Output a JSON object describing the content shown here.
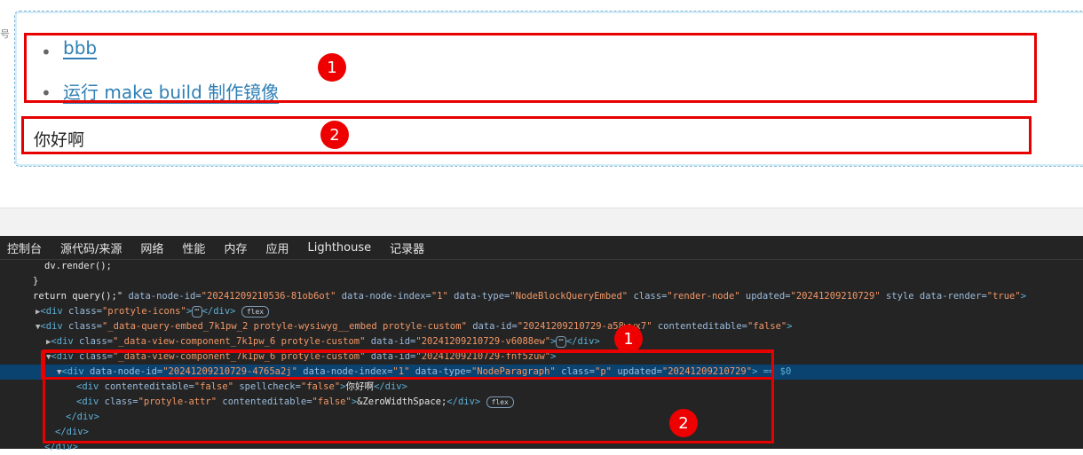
{
  "preview": {
    "side_mark": "号",
    "list_items": [
      {
        "label": "bbb"
      },
      {
        "label": "运行 make build 制作镜像"
      }
    ],
    "paragraph": "你好啊",
    "badges": [
      "1",
      "2"
    ]
  },
  "devtools": {
    "tabs": [
      "控制台",
      "源代码/来源",
      "网络",
      "性能",
      "内存",
      "应用",
      "Lighthouse",
      "记录器"
    ],
    "code_lines": {
      "l1": "dv.render();",
      "l2": "}",
      "l3_a": "return query();\"",
      "l3_b": " data-node-id=",
      "l3_c": "\"20241209210536-81ob6ot\"",
      "l3_d": " data-node-index=",
      "l3_e": "\"1\"",
      "l3_f": " data-type=",
      "l3_g": "\"NodeBlockQueryEmbed\"",
      "l3_h": " class=",
      "l3_i": "\"render-node\"",
      "l3_j": " updated=",
      "l3_k": "\"20241209210729\"",
      "l3_l": " style data-render=",
      "l3_m": "\"true\"",
      "l3_n": ">",
      "l4_tag": "<div",
      "l4_attr": " class=",
      "l4_val": "\"protyle-icons\"",
      "l4_end": ">",
      "l4_close": "</div>",
      "l5_val": "\"_data-query-embed_7k1pw_2 protyle-wysiwyg__embed protyle-custom\"",
      "l5_attr2": " data-id=",
      "l5_val2": "\"20241209210729-a58wwx7\"",
      "l5_attr3": " contenteditable=",
      "l5_val3": "\"false\"",
      "l6_val": "\"_data-view-component_7k1pw_6 protyle-custom\"",
      "l6_val2": "\"20241209210729-v6088ew\"",
      "l7_val": "\"_data-view-component_7k1pw_6 protyle-custom\"",
      "l7_val2": "\"20241209210729-fnf5zuw\"",
      "l8_tag": "<div",
      "l8_a1": " data-node-id=",
      "l8_v1": "\"20241209210729-4765a2j\"",
      "l8_a2": " data-node-index=",
      "l8_v2": "\"1\"",
      "l8_a3": " data-type=",
      "l8_v3": "\"NodeParagraph\"",
      "l8_a4": " class=",
      "l8_v4": "\"p\"",
      "l8_a5": " updated=",
      "l8_v5": "\"20241209210729\"",
      "l8_end": "> == $0",
      "l9_attr": " contenteditable=",
      "l9_val": "\"false\"",
      "l9_attr2": " spellcheck=",
      "l9_val2": "\"false\"",
      "l9_text": "你好啊",
      "l10_val": "\"protyle-attr\"",
      "l10_attr2": " contenteditable=",
      "l10_val2": "\"false\"",
      "l10_text": "&ZeroWidthSpace;",
      "close_div": "</div>",
      "flex": "flex",
      "ellipsis": "⋯",
      "div_open": "<div",
      "class_attr": " class=",
      "data_id_attr": " data-id="
    }
  },
  "colors": {
    "highlight": "#e60000",
    "link": "#2f7fb5",
    "devtools_bg": "#242424",
    "selected_line": "#0b4370"
  }
}
